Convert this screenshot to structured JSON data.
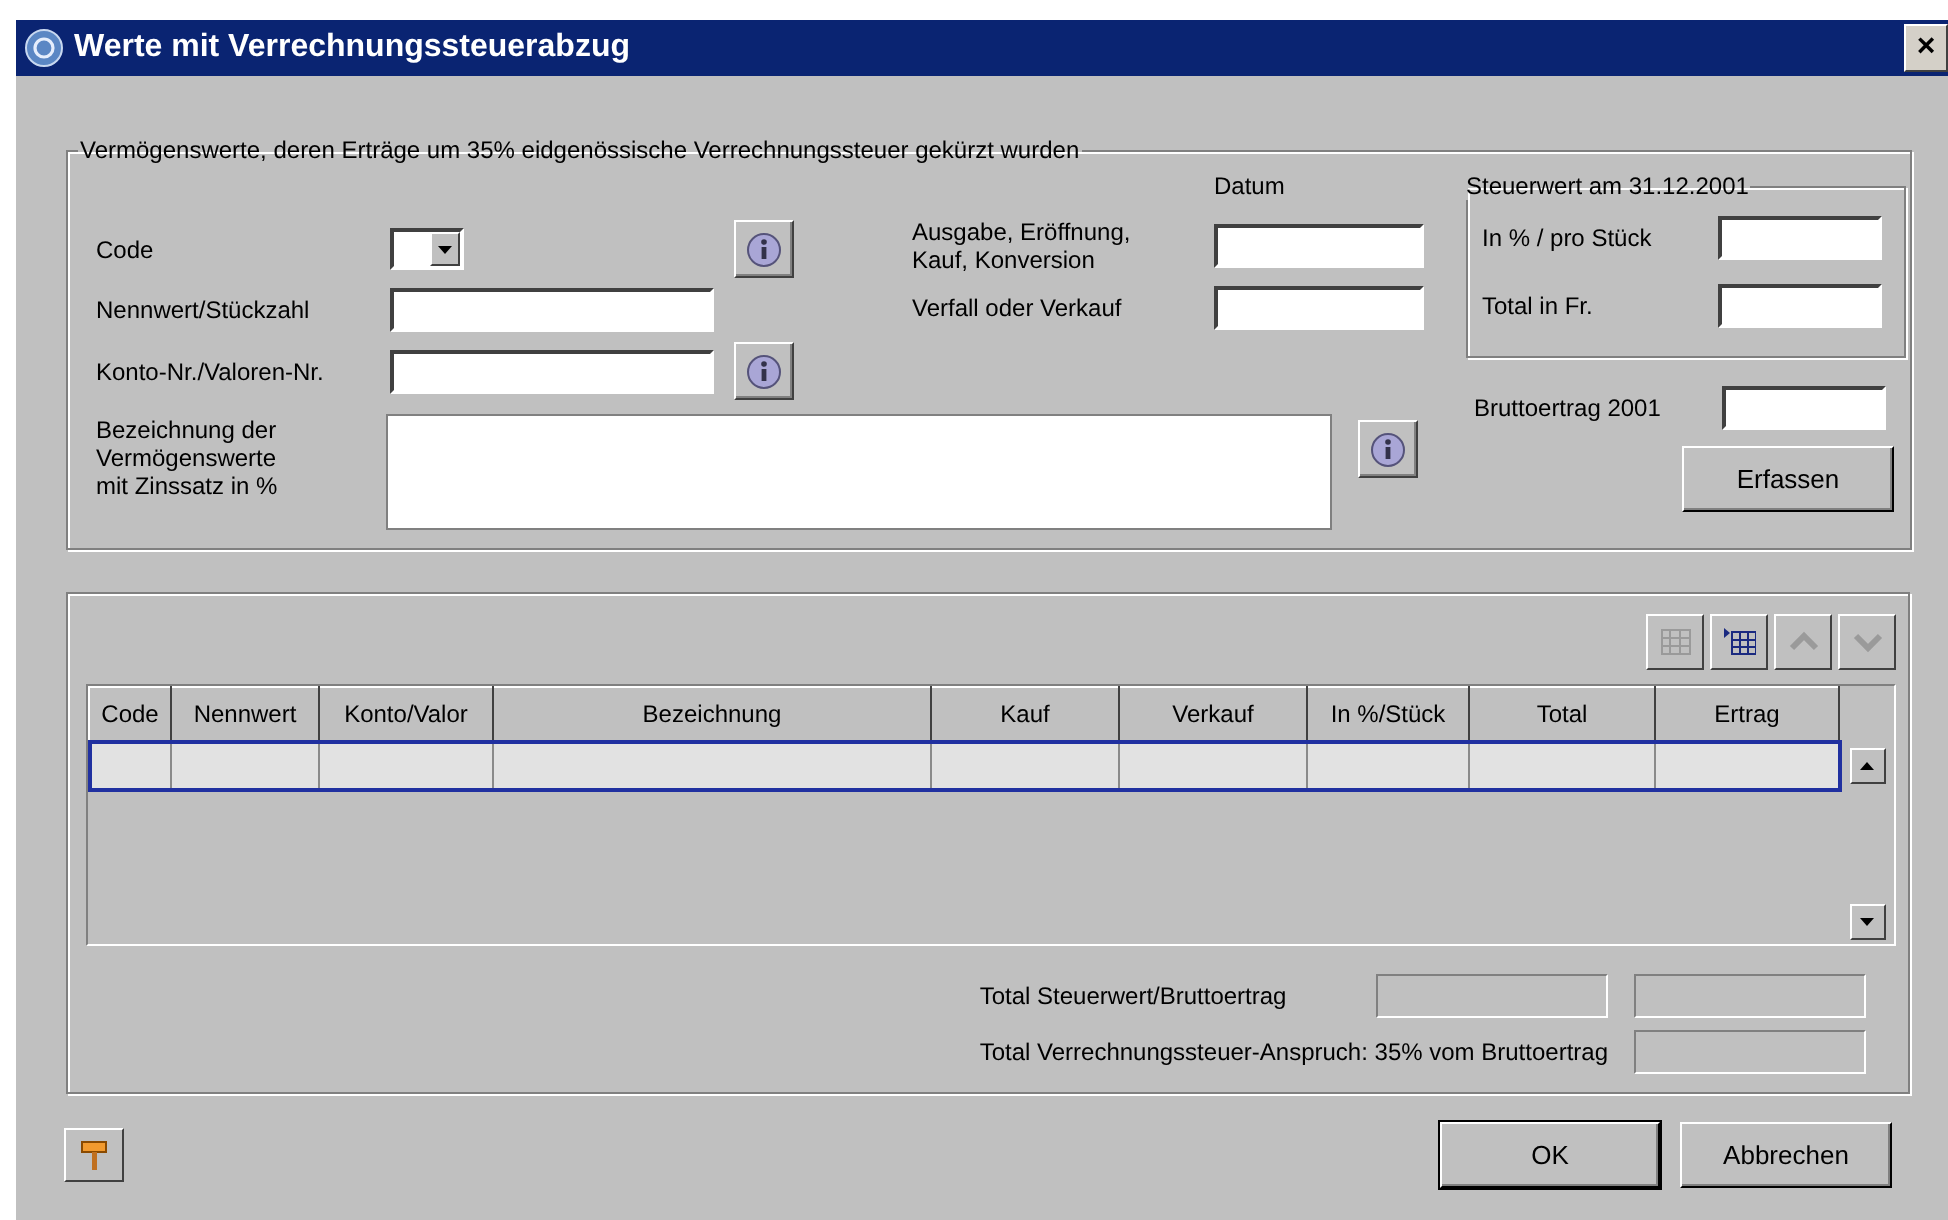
{
  "window": {
    "title": "Werte mit Verrechnungssteuerabzug",
    "close": "×"
  },
  "assets_group": {
    "legend": "Vermögenswerte, deren Erträge um 35% eidgenössische Verrechnungssteuer gekürzt wurden",
    "code": {
      "label": "Code"
    },
    "nennwert": {
      "label": "Nennwert/Stückzahl"
    },
    "konto": {
      "label": "Konto-Nr./Valoren-Nr."
    },
    "bezeichnung": {
      "label": "Bezeichnung der\nVermögenswerte\nmit Zinssatz in %"
    },
    "datum_heading": "Datum",
    "ausgabe": {
      "label": "Ausgabe, Eröffnung,\nKauf, Konversion"
    },
    "verfall": {
      "label": "Verfall oder Verkauf"
    },
    "steuerwert": {
      "legend": "Steuerwert am 31.12.2001",
      "in_prozent": {
        "label": "In % / pro Stück"
      },
      "total": {
        "label": "Total in Fr."
      }
    },
    "bruttoertrag": {
      "label": "Bruttoertrag 2001"
    },
    "erfassen_button": "Erfassen"
  },
  "toolbar": [
    {
      "kind": "grid",
      "disabled": true
    },
    {
      "kind": "insert",
      "disabled": false
    },
    {
      "kind": "up",
      "disabled": true
    },
    {
      "kind": "down",
      "disabled": true
    }
  ],
  "table": {
    "columns": [
      "Code",
      "Nennwert",
      "Konto/Valor",
      "Bezeichnung",
      "Kauf",
      "Verkauf",
      "In %/Stück",
      "Total",
      "Ertrag"
    ],
    "rows": [
      {
        "selected": true
      }
    ]
  },
  "totals": [
    {
      "label": "Total Steuerwert/Bruttoertrag",
      "kind": "double"
    },
    {
      "label": "Total Verrechnungssteuer-Anspruch: 35% vom Bruttoertrag",
      "kind": "single"
    }
  ],
  "buttons": {
    "ok": "OK",
    "cancel": "Abbrechen"
  }
}
